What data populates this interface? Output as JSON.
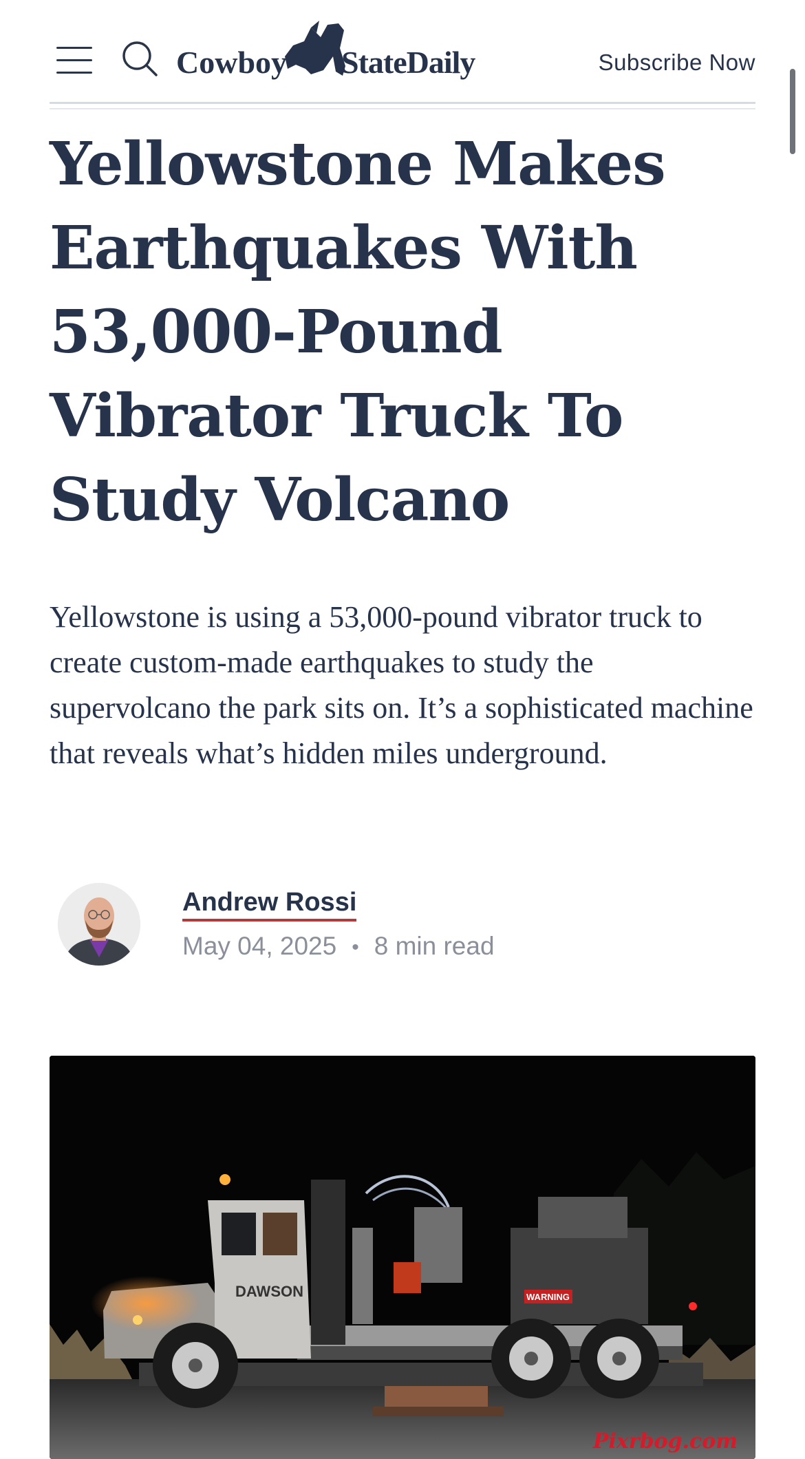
{
  "header": {
    "menu_icon": "hamburger-menu-icon",
    "search_icon": "search-icon",
    "logo_left": "Cowboy",
    "logo_right": "StateDaily",
    "subscribe_label": "Subscribe Now"
  },
  "article": {
    "headline": "Yellowstone Makes Earthquakes With 53,000-Pound Vibrator Truck To Study Volcano",
    "dek": "Yellowstone is using a 53,000-pound vibrator truck to create custom-made earthquakes to study the supervolcano the park sits on. It’s a sophisticated machine that reveals what’s hidden miles underground.",
    "author": "Andrew Rossi",
    "date": "May 04, 2025",
    "read_time": "8 min read",
    "image_truck_label": "DAWSON",
    "image_warning_label": "WARNING",
    "watermark": "Pixrbog.com"
  },
  "colors": {
    "text": "#26334a",
    "meta": "#8a8f99",
    "author_underline": "#b23a3a",
    "watermark": "#d61a2a"
  }
}
